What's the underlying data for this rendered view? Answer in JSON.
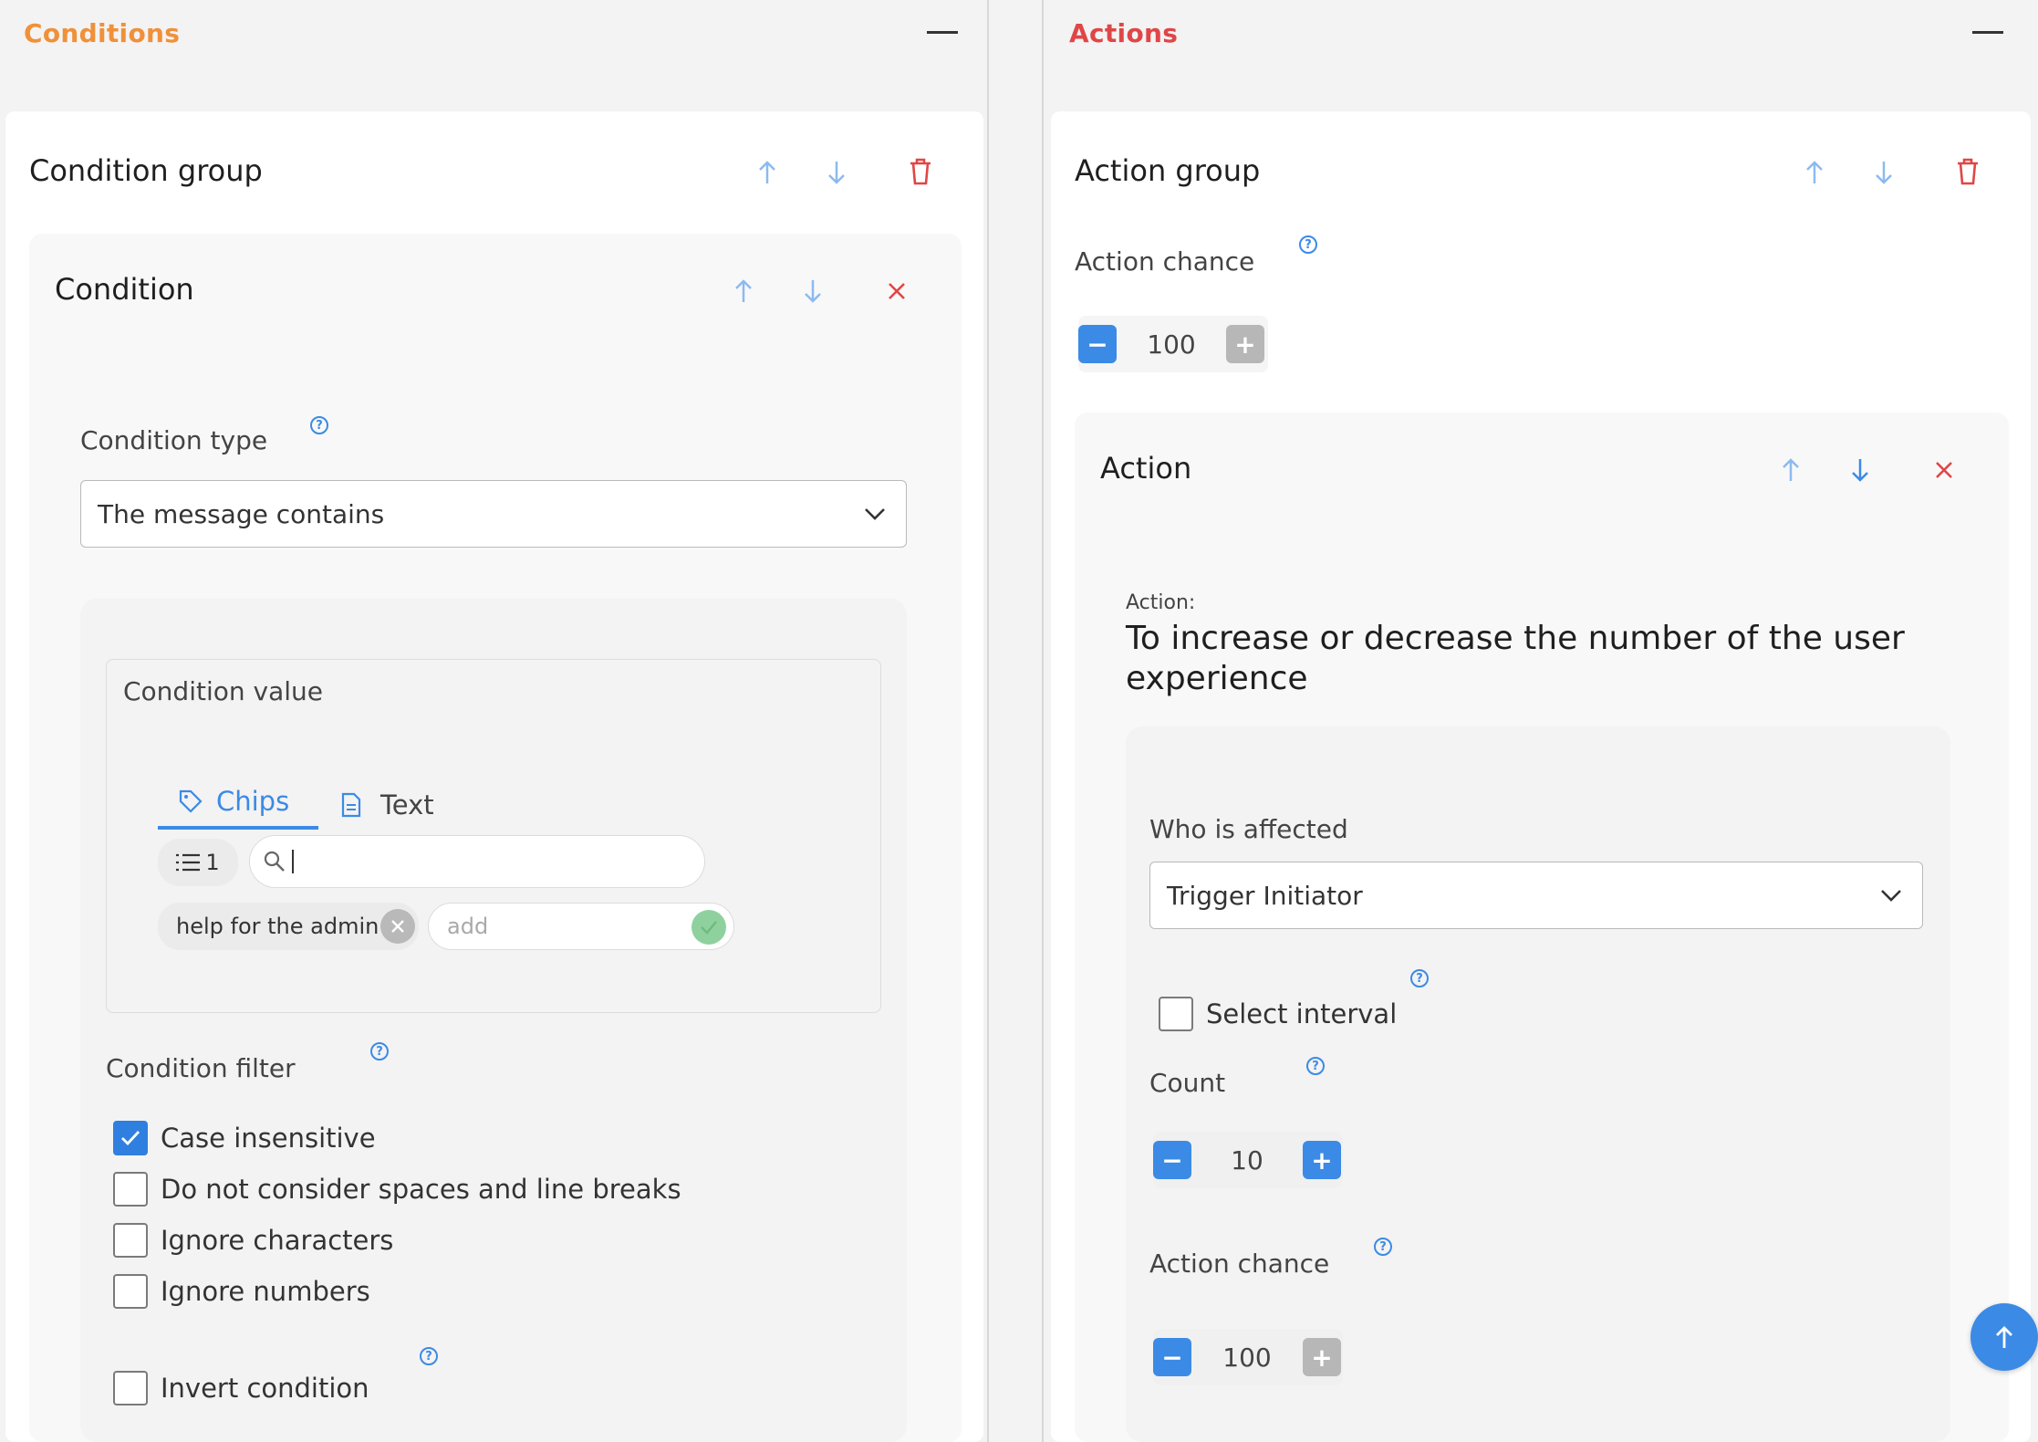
{
  "conditions": {
    "header_title": "Conditions",
    "header_color": "#f0903a",
    "group": {
      "title": "Condition group",
      "condition": {
        "title": "Condition",
        "type_label": "Condition type",
        "type_value": "The message contains",
        "value_section": {
          "title": "Condition value",
          "tabs": [
            {
              "label": "Chips",
              "icon": "tag-icon",
              "active": true
            },
            {
              "label": "Text",
              "icon": "document-icon",
              "active": false
            }
          ],
          "list_count": "1",
          "search_value": "",
          "chips": [
            "help for the admin"
          ],
          "add_placeholder": "add"
        },
        "filter": {
          "title": "Condition filter",
          "options": [
            {
              "label": "Case insensitive",
              "checked": true
            },
            {
              "label": "Do not consider spaces and line breaks",
              "checked": false
            },
            {
              "label": "Ignore characters",
              "checked": false
            },
            {
              "label": "Ignore numbers",
              "checked": false
            }
          ],
          "invert_label": "Invert condition",
          "invert_checked": false
        }
      }
    }
  },
  "actions": {
    "header_title": "Actions",
    "header_color": "#e04646",
    "group": {
      "title": "Action group",
      "chance_label": "Action chance",
      "chance_value": "100",
      "action": {
        "title": "Action",
        "action_caption": "Action:",
        "action_name": "To increase or decrease the number of the user experience",
        "who_label": "Who is affected",
        "who_value": "Trigger Initiator",
        "select_interval_label": "Select interval",
        "select_interval_checked": false,
        "count_label": "Count",
        "count_value": "10",
        "chance_label": "Action chance",
        "chance_value": "100"
      }
    }
  },
  "colors": {
    "accent_blue": "#3b8ae6",
    "danger_red": "#e04646",
    "check_green": "#8fd19e"
  }
}
